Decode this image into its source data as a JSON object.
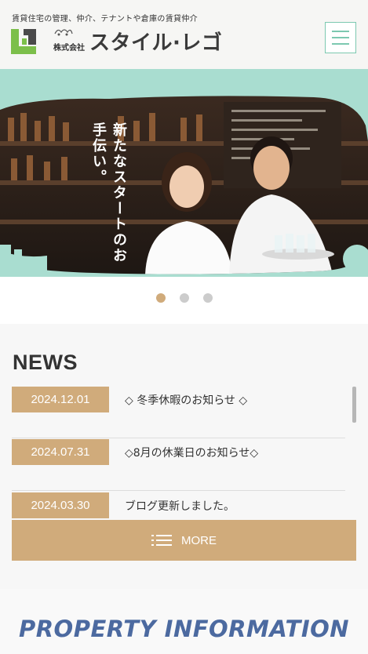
{
  "header": {
    "tagline": "賃貸住宅の管理、仲介、テナントや倉庫の賃貸仲介",
    "logo_small": "株式会社",
    "logo_main": "スタイル·レゴ",
    "menu_icon": "hamburger-icon"
  },
  "hero": {
    "copy": "新たなスタートのお手伝い。",
    "slides": 3,
    "active_slide": 1
  },
  "news": {
    "title": "NEWS",
    "items": [
      {
        "date": "2024.12.01",
        "text": "◇ 冬季休暇のお知らせ ◇"
      },
      {
        "date": "2024.07.31",
        "text": "◇8月の休業日のお知らせ◇"
      },
      {
        "date": "2024.03.30",
        "text": "ブログ更新しました。"
      }
    ],
    "more_label": "MORE"
  },
  "property": {
    "title": "PROPERTY INFORMATION"
  },
  "colors": {
    "accent": "#d0ab7b",
    "mint": "#a9ddd0",
    "menu": "#7cc8b0",
    "logo_green": "#7cbf4a",
    "property_blue": "#4c6aa0"
  }
}
